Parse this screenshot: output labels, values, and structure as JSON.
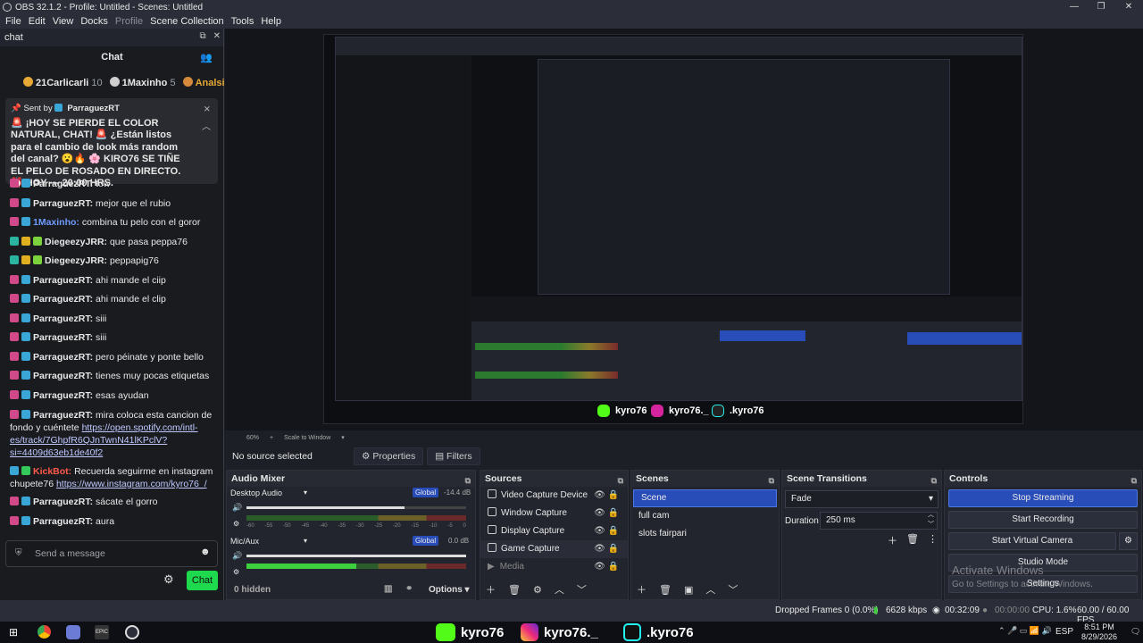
{
  "window": {
    "title": "OBS 32.1.2 - Profile: Untitled - Scenes: Untitled"
  },
  "menu": {
    "items": [
      "File",
      "Edit",
      "View",
      "Docks",
      "Profile",
      "Scene Collection",
      "Tools",
      "Help"
    ]
  },
  "chat_dock": {
    "dock_title": "chat",
    "title": "Chat",
    "leaders": [
      {
        "name": "21Carlicarli",
        "score": "10",
        "color": "#e7a935"
      },
      {
        "name": "1Maxinho",
        "score": "5",
        "color": "#cfcfcf"
      },
      {
        "name": "Analsi",
        "score": "",
        "color": "#d48a3a"
      }
    ],
    "pinned": {
      "sent_by": "Sent by",
      "user": "ParraguezRT",
      "text": "🚨 ¡HOY SE PIERDE EL COLOR NATURAL, CHAT! 🚨 ¿Están listos para el cambio de look más random del canal? 😮🔥 🌸 KIRO76 SE TIÑE EL PELO DE ROSADO EN DIRECTO. ⏰ HOY — 20:00 HRS."
    },
    "messages": [
      {
        "user": "ParraguezRT:",
        "text": "tow",
        "color": "#e8e8e8",
        "badge": "#3aa6d6"
      },
      {
        "user": "ParraguezRT:",
        "text": "mejor que el rubio",
        "color": "#e8e8e8",
        "badge": "#3aa6d6"
      },
      {
        "user": "1Maxinho:",
        "text": "combina tu pelo con el goror",
        "color": "#6f9bff",
        "badge": "#3aa6d6"
      },
      {
        "user": "DiegeezyJRR:",
        "text": "que pasa peppa76",
        "color": "#e8e8e8",
        "badge": "#e0b020"
      },
      {
        "user": "DiegeezyJRR:",
        "text": "peppapig76",
        "color": "#e8e8e8",
        "badge": "#e0b020"
      },
      {
        "user": "ParraguezRT:",
        "text": "ahi mande el ciip",
        "color": "#e8e8e8",
        "badge": "#3aa6d6"
      },
      {
        "user": "ParraguezRT:",
        "text": "ahi mande el clip",
        "color": "#e8e8e8",
        "badge": "#3aa6d6"
      },
      {
        "user": "ParraguezRT:",
        "text": "siii",
        "color": "#e8e8e8",
        "badge": "#3aa6d6"
      },
      {
        "user": "ParraguezRT:",
        "text": "siii",
        "color": "#e8e8e8",
        "badge": "#3aa6d6"
      },
      {
        "user": "ParraguezRT:",
        "text": "pero péinate y ponte bello",
        "color": "#e8e8e8",
        "badge": "#3aa6d6"
      },
      {
        "user": "ParraguezRT:",
        "text": "tienes muy pocas etiquetas",
        "color": "#e8e8e8",
        "badge": "#3aa6d6"
      },
      {
        "user": "ParraguezRT:",
        "text": "esas ayudan",
        "color": "#e8e8e8",
        "badge": "#3aa6d6"
      }
    ],
    "wrap1": {
      "user": "ParraguezRT:",
      "text": "mira coloca esta cancion de fondo y cuéntete",
      "link": "https://open.spotify.com/intl-es/track/7GhpfR6QJnTwnN41lKPclV?si=4409d63eb1de40f2"
    },
    "wrap2": {
      "user": "KickBot:",
      "text": "Recuerda seguirme en instagram chupete76",
      "link": "https://www.instagram.com/kyro76_/"
    },
    "tail": [
      {
        "user": "ParraguezRT:",
        "text": "sácate el gorro"
      },
      {
        "user": "ParraguezRT:",
        "text": "aura"
      }
    ],
    "input_placeholder": "Send a message",
    "send_label": "Chat"
  },
  "preview": {
    "zoom": "60%",
    "scale_label": "Scale to Window",
    "brands": [
      {
        "icon": "kick",
        "label": "kyro76"
      },
      {
        "icon": "instagram",
        "label": "kyro76._"
      },
      {
        "icon": "tiktok",
        "label": ".kyro76"
      }
    ],
    "activate_windows": "Activate Windows",
    "activate_sub": "Go to Settings to activate Windows."
  },
  "props_bar": {
    "no_source": "No source selected",
    "properties": "Properties",
    "filters": "Filters"
  },
  "audio_mixer": {
    "title": "Audio Mixer",
    "channels": [
      {
        "name": "Desktop Audio",
        "badge": "Global",
        "db": "-14.4 dB",
        "level": 0.72
      },
      {
        "name": "Mic/Aux",
        "badge": "Global",
        "db": "0.0 dB",
        "level": 1.0
      }
    ],
    "ticks": [
      "-60",
      "-55",
      "-50",
      "-45",
      "-40",
      "-35",
      "-30",
      "-25",
      "-20",
      "-15",
      "-10",
      "-5",
      "0"
    ],
    "hidden": "0 hidden",
    "options": "Options"
  },
  "sources": {
    "title": "Sources",
    "items": [
      "Video Capture Device",
      "Window Capture",
      "Display Capture",
      "Game Capture",
      "Media"
    ]
  },
  "scenes": {
    "title": "Scenes",
    "items": [
      "Scene",
      "full cam",
      "slots fairpari"
    ]
  },
  "transitions": {
    "title": "Scene Transitions",
    "type": "Fade",
    "duration_label": "Duration",
    "duration": "250 ms"
  },
  "controls": {
    "title": "Controls",
    "buttons": [
      "Stop Streaming",
      "Start Recording",
      "Start Virtual Camera",
      "Studio Mode",
      "Settings"
    ]
  },
  "status": {
    "dropped": "Dropped Frames 0 (0.0%)",
    "kbps": "6628 kbps",
    "stream_time": "00:32:09",
    "rec_time": "00:00:00",
    "cpu": "CPU: 1.6%",
    "fps": "60.00 / 60.00 FPS"
  },
  "taskbar": {
    "lang": "ESP",
    "time": "8:51 PM",
    "date": "8/29/2026"
  }
}
